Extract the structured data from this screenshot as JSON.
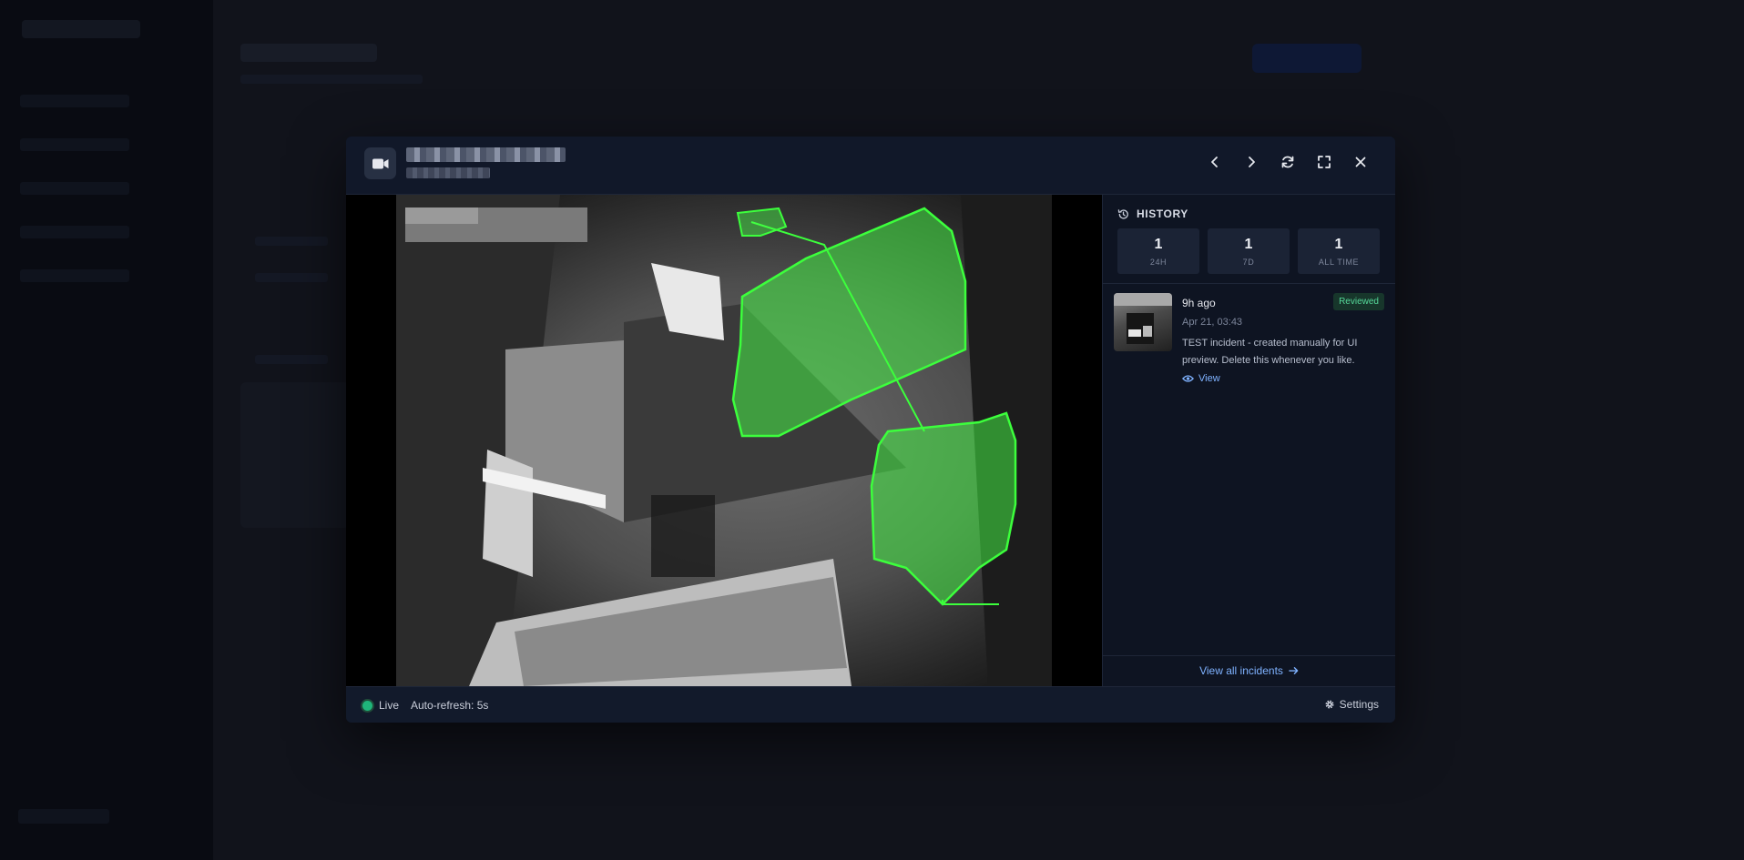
{
  "modal": {
    "camera_title": "████ ██████ ███",
    "camera_subtitle": "██████"
  },
  "history": {
    "title": "HISTORY",
    "stats": [
      {
        "value": "1",
        "label": "24H"
      },
      {
        "value": "1",
        "label": "7D"
      },
      {
        "value": "1",
        "label": "ALL TIME"
      }
    ],
    "incidents": [
      {
        "time_ago": "9h ago",
        "status": "Reviewed",
        "date": "Apr 21, 03:43",
        "description": "TEST incident - created manually for UI preview. Delete this whenever you like.",
        "view_label": "View"
      }
    ],
    "view_all_label": "View all incidents"
  },
  "footer": {
    "live_label": "Live",
    "refresh_label": "Auto-refresh: 5s",
    "settings_label": "Settings"
  },
  "colors": {
    "accent": "#7fb2ff",
    "live": "#1fb57a",
    "detection": "#3cff3c",
    "reviewed": "#56d99a"
  },
  "icons": [
    "video-camera-icon",
    "chevron-left-icon",
    "chevron-right-icon",
    "refresh-icon",
    "fullscreen-icon",
    "close-icon",
    "history-icon",
    "eye-icon",
    "arrow-right-icon",
    "gear-icon"
  ]
}
